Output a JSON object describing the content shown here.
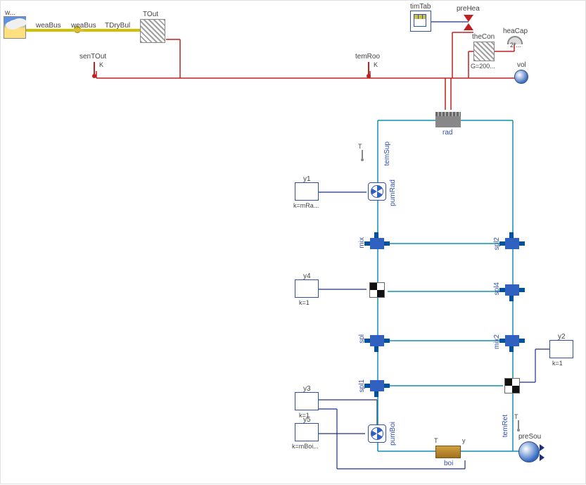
{
  "diagram": {
    "weather": {
      "label": "w..."
    },
    "weaBus": {
      "label": "weaBus",
      "label2": "weaBus"
    },
    "TDryBul": {
      "label": "TDryBul"
    },
    "TOut": {
      "label": "TOut"
    },
    "senTOut": {
      "label": "senTOut",
      "unit": "K"
    },
    "temRoo": {
      "label": "temRoo",
      "unit": "K"
    },
    "timTab": {
      "label": "timTab"
    },
    "preHea": {
      "label": "preHea"
    },
    "theCon": {
      "label": "theCon",
      "param": "G=200..."
    },
    "heaCap": {
      "label": "heaCap",
      "param": "2*..."
    },
    "vol": {
      "label": "vol"
    },
    "rad": {
      "label": "rad"
    },
    "temSup": {
      "label": "temSup"
    },
    "pumRad": {
      "label": "pumRad"
    },
    "mix": {
      "label": "mix"
    },
    "spl": {
      "label": "spl"
    },
    "spl1": {
      "label": "spl1"
    },
    "spl2": {
      "label": "spl2"
    },
    "spl4": {
      "label": "spl4"
    },
    "mix2": {
      "label": "mix2"
    },
    "temRet": {
      "label": "temRet"
    },
    "pumBoi": {
      "label": "pumBoi"
    },
    "boi": {
      "label": "boi",
      "Tlabel": "T",
      "ylabel": "y"
    },
    "preSou": {
      "label": "preSou"
    },
    "y1": {
      "label": "y1",
      "param": "k=mRa..."
    },
    "y4": {
      "label": "y4",
      "param": "k=1"
    },
    "y3": {
      "label": "y3",
      "param": "k=1"
    },
    "y5": {
      "label": "y5",
      "param": "k=mBoi..."
    },
    "y2": {
      "label": "y2",
      "param": "k=1"
    }
  }
}
